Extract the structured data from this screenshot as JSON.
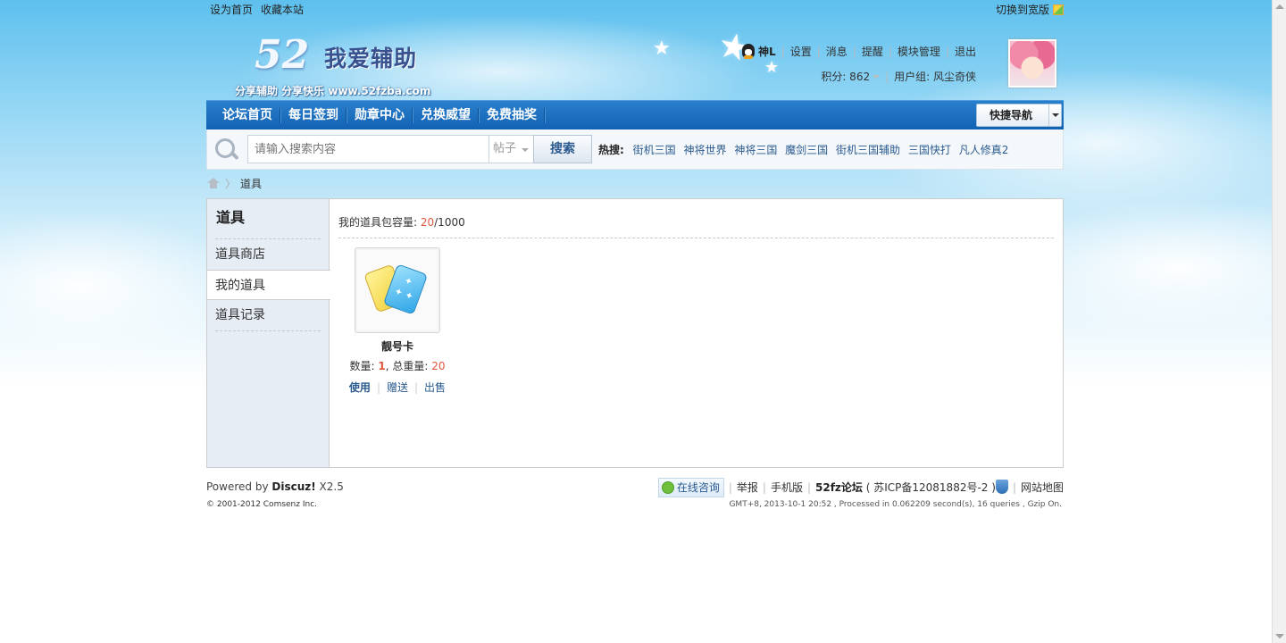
{
  "topbar": {
    "set_home": "设为首页",
    "bookmark": "收藏本站",
    "switch_wide": "切换到宽版"
  },
  "logo": {
    "number": "52",
    "title": "我爱辅助",
    "slogan": "分享辅助  分享快乐  www.52fzba.com"
  },
  "user": {
    "name": "神L",
    "links": [
      "设置",
      "消息",
      "提醒",
      "模块管理",
      "退出"
    ],
    "points_label": "积分: 862",
    "group_label": "用户组: 风尘奇侠"
  },
  "nav": {
    "items": [
      "论坛首页",
      "每日签到",
      "勋章中心",
      "兑换威望",
      "免费抽奖"
    ],
    "quick_nav": "快捷导航"
  },
  "search": {
    "placeholder": "请输入搜索内容",
    "type": "帖子",
    "button": "搜索",
    "hot_label": "热搜:",
    "hot_items": [
      "街机三国",
      "神将世界",
      "神将三国",
      "魔剑三国",
      "街机三国辅助",
      "三国快打",
      "凡人修真2"
    ]
  },
  "breadcrumb": {
    "current": "道具"
  },
  "sidebar": {
    "title": "道具",
    "items": [
      "道具商店",
      "我的道具",
      "道具记录"
    ]
  },
  "bag": {
    "label": "我的道具包容量: ",
    "used": "20",
    "total": "/1000"
  },
  "item": {
    "name": "靓号卡",
    "qty_label": "数量: ",
    "qty": "1",
    "weight_label": ", 总重量: ",
    "weight": "20",
    "ops": [
      "使用",
      "赠送",
      "出售"
    ]
  },
  "footer": {
    "powered_prefix": "Powered by ",
    "powered_brand": "Discuz!",
    "powered_version": " X2.5",
    "copyright": "© 2001-2012 Comsenz Inc.",
    "online": "在线咨询",
    "report": "举报",
    "mobile": "手机版",
    "site_name": "52fz论坛",
    "icp": "( 苏ICP备12081882号-2 )",
    "sitemap": "网站地图",
    "gmt": "GMT+8, 2013-10-1 20:52 , Processed in 0.062209 second(s), 16 queries , Gzip On."
  },
  "colors": {
    "nav_blue": "#1a6dc0",
    "link_blue": "#2a5a8f",
    "accent_red": "#e0563d",
    "sidebar_bg": "#e7edf5"
  }
}
